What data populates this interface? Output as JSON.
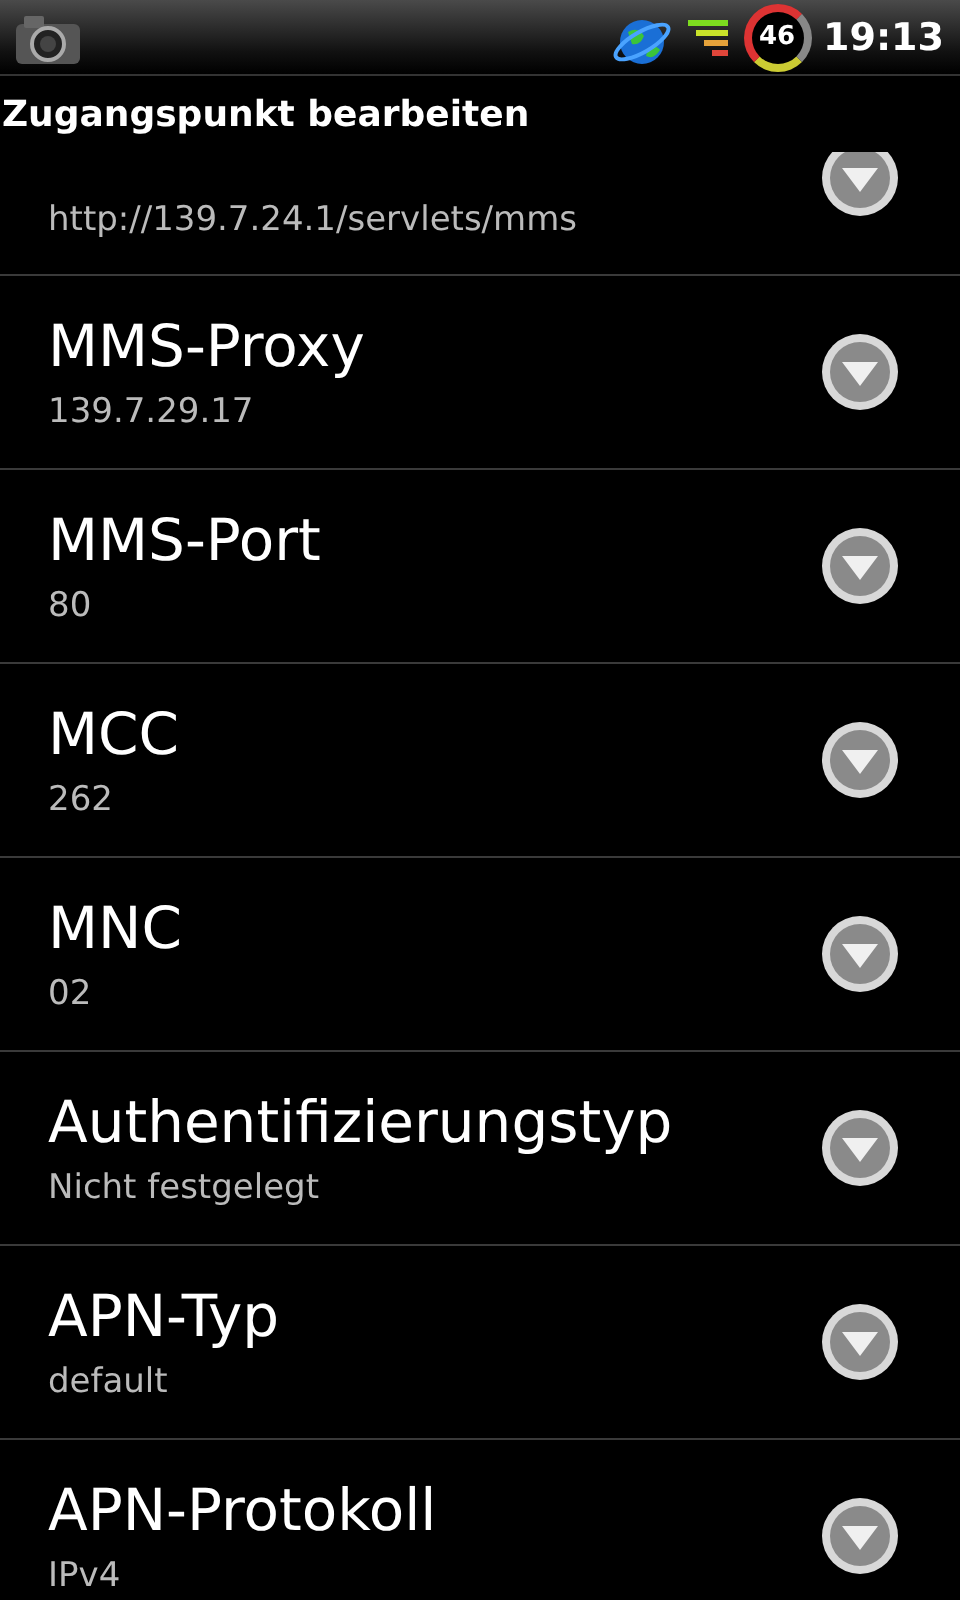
{
  "status_bar": {
    "battery": "46",
    "time": "19:13"
  },
  "title": "Zugangspunkt bearbeiten",
  "settings": [
    {
      "value": "http://139.7.24.1/servlets/mms"
    },
    {
      "title": "MMS-Proxy",
      "value": "139.7.29.17"
    },
    {
      "title": "MMS-Port",
      "value": "80"
    },
    {
      "title": "MCC",
      "value": "262"
    },
    {
      "title": "MNC",
      "value": "02"
    },
    {
      "title": "Authentifizierungstyp",
      "value": "Nicht festgelegt"
    },
    {
      "title": "APN-Typ",
      "value": "default"
    },
    {
      "title": "APN-Protokoll",
      "value": "IPv4"
    }
  ]
}
